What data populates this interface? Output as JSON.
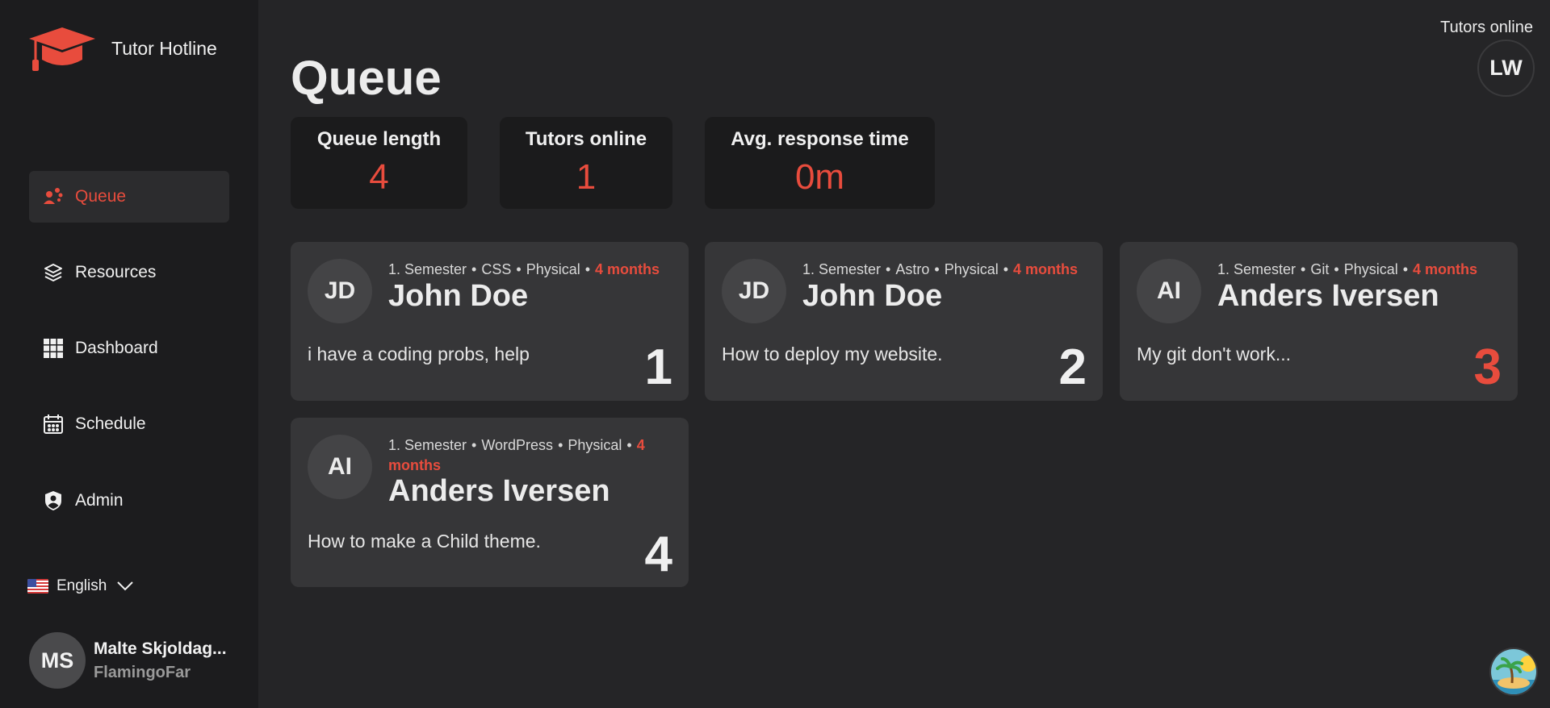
{
  "brand": {
    "name": "Tutor Hotline"
  },
  "page": {
    "title": "Queue"
  },
  "header": {
    "tutors_online_label": "Tutors online",
    "avatar_initials": "LW"
  },
  "nav": [
    {
      "label": "Queue",
      "icon": "queue-people-icon",
      "active": true
    },
    {
      "label": "Resources",
      "icon": "layers-icon",
      "active": false
    },
    {
      "label": "Dashboard",
      "icon": "grid-icon",
      "active": false
    },
    {
      "label": "Schedule",
      "icon": "calendar-icon",
      "active": false
    },
    {
      "label": "Admin",
      "icon": "shield-user-icon",
      "active": false
    }
  ],
  "language": {
    "label": "English"
  },
  "user": {
    "initials": "MS",
    "name": "Malte Skjoldag...",
    "handle": "FlamingoFar"
  },
  "stats": [
    {
      "label": "Queue length",
      "value": "4"
    },
    {
      "label": "Tutors online",
      "value": "1"
    },
    {
      "label": "Avg. response time",
      "value": "0m"
    }
  ],
  "queue": [
    {
      "initials": "JD",
      "semester": "1. Semester",
      "topic": "CSS",
      "mode": "Physical",
      "age": "4 months",
      "name": "John Doe",
      "question": "i have a coding probs, help",
      "position": "1"
    },
    {
      "initials": "JD",
      "semester": "1. Semester",
      "topic": "Astro",
      "mode": "Physical",
      "age": "4 months",
      "name": "John Doe",
      "question": "How to deploy my website.",
      "position": "2"
    },
    {
      "initials": "AI",
      "semester": "1. Semester",
      "topic": "Git",
      "mode": "Physical",
      "age": "4 months",
      "name": "Anders Iversen",
      "question": "My git don't work...",
      "position": "3"
    },
    {
      "initials": "AI",
      "semester": "1. Semester",
      "topic": "WordPress",
      "mode": "Physical",
      "age": "4 months",
      "name": "Anders Iversen",
      "question": "How to make a Child theme.",
      "position": "4"
    }
  ],
  "colors": {
    "accent": "#e84c3d",
    "sidebar": "#1c1c1e",
    "background": "#252527",
    "card": "#363638"
  }
}
